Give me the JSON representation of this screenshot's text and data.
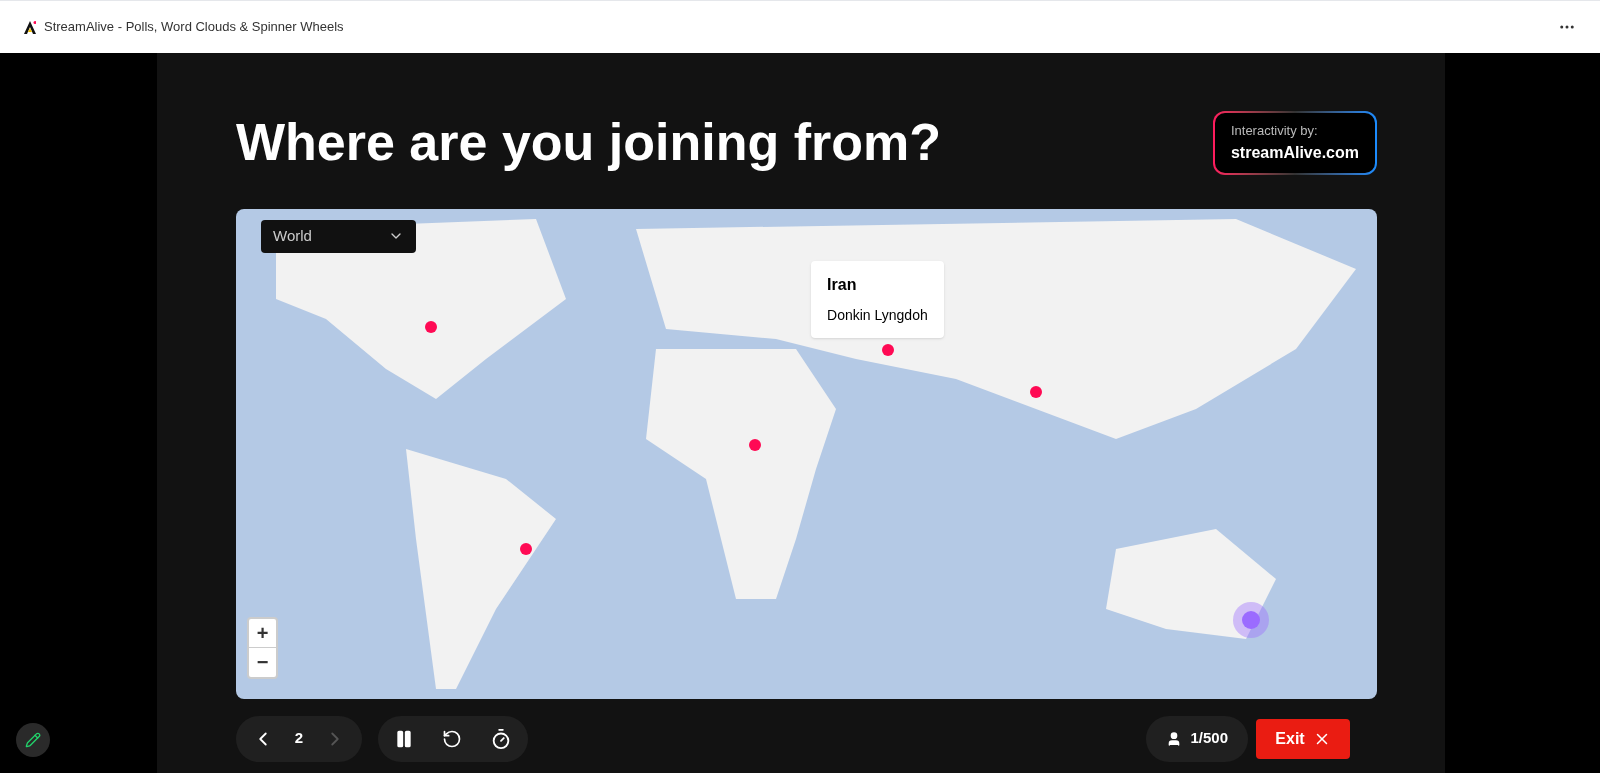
{
  "window": {
    "title": "StreamAlive - Polls, Word Clouds & Spinner Wheels"
  },
  "heading": "Where are you joining from?",
  "badge": {
    "caption": "Interactivity by:",
    "brand": "streamAlive.com"
  },
  "map": {
    "region_select": "World",
    "pins": [
      {
        "color": "#ff0a54"
      },
      {
        "color": "#ff0a54"
      },
      {
        "color": "#ff0a54"
      },
      {
        "color": "#ff0a54"
      },
      {
        "color": "#ff0a54"
      },
      {
        "color": "#9b6bff"
      }
    ],
    "tooltip": {
      "country": "Iran",
      "name": "Donkin Lyngdoh"
    },
    "zoom": {
      "in": "+",
      "out": "−"
    }
  },
  "pager": {
    "page": "2",
    "prev_disabled": false,
    "next_disabled": true
  },
  "participants": "1/500",
  "exit": "Exit"
}
